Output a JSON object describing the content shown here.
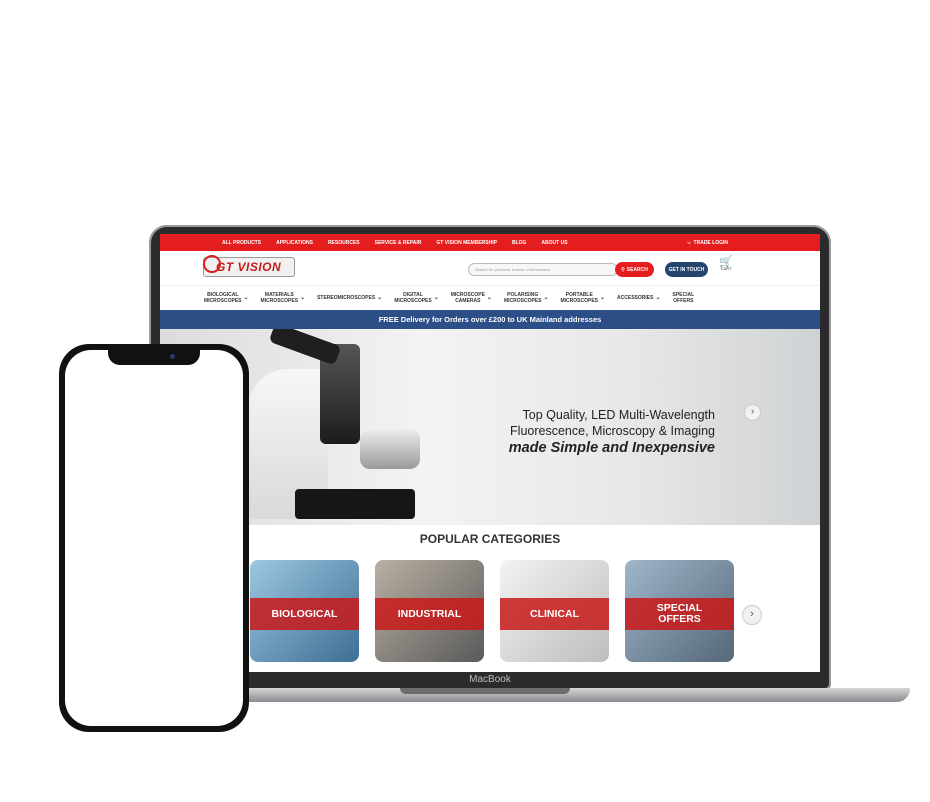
{
  "laptop": {
    "brand_label": "MacBook"
  },
  "site": {
    "top_nav": [
      "ALL PRODUCTS",
      "APPLICATIONS",
      "RESOURCES",
      "SERVICE & REPAIR",
      "GT VISION MEMBERSHIP",
      "BLOG",
      "ABOUT US"
    ],
    "trade_login": "TRADE LOGIN",
    "logo_text": "GT VISION",
    "search_placeholder": "Search for products, brands or information",
    "search_button": "SEARCH",
    "get_in_touch": "GET IN TOUCH",
    "cart_label": "CART",
    "categories": [
      {
        "l1": "BIOLOGICAL",
        "l2": "MICROSCOPES"
      },
      {
        "l1": "MATERIALS",
        "l2": "MICROSCOPES"
      },
      {
        "l1": "STEREOMICROSCOPES",
        "l2": ""
      },
      {
        "l1": "DIGITAL",
        "l2": "MICROSCOPES"
      },
      {
        "l1": "MICROSCOPE",
        "l2": "CAMERAS"
      },
      {
        "l1": "POLARISING",
        "l2": "MICROSCOPES"
      },
      {
        "l1": "PORTABLE",
        "l2": "MICROSCOPES"
      },
      {
        "l1": "ACCESSORIES",
        "l2": ""
      },
      {
        "l1": "SPECIAL",
        "l2": "OFFERS"
      }
    ],
    "delivery_banner": "FREE Delivery for Orders over £200 to UK Mainland addresses",
    "hero": {
      "line1": "Top Quality, LED Multi-Wavelength",
      "line2": "Fluorescence, Microscopy & Imaging",
      "line3": "made Simple and Inexpensive"
    },
    "popular_title": "POPULAR CATEGORIES",
    "popular_cards": [
      {
        "label": "BIOLOGICAL"
      },
      {
        "label": "INDUSTRIAL"
      },
      {
        "label": "CLINICAL"
      },
      {
        "label": "SPECIAL OFFERS"
      }
    ]
  },
  "icons": {
    "user": "user-icon",
    "search": "search-icon",
    "cart": "cart-icon",
    "chevron": "chevron-down-icon",
    "next": "chevron-right-icon"
  },
  "colors": {
    "brand_red": "#e41e1e",
    "brand_blue": "#24466e",
    "banner_blue": "#2d4f88"
  }
}
